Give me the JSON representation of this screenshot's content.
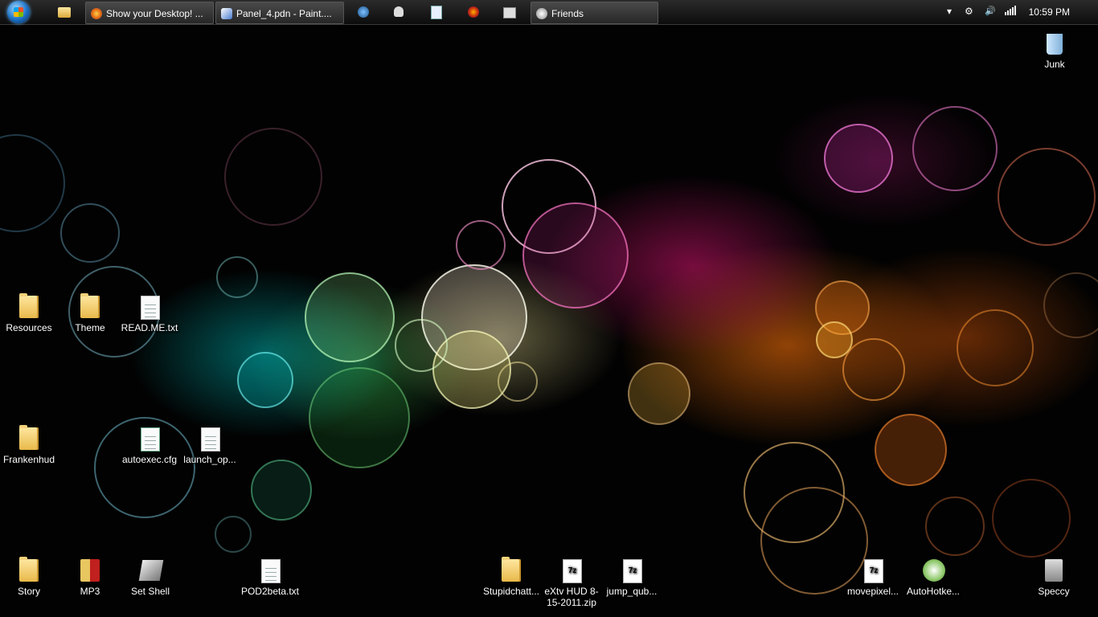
{
  "taskbar": {
    "tasks": [
      {
        "label": "Show your Desktop! ...",
        "icon": "firefox-icon"
      },
      {
        "label": "Panel_4.pdn - Paint....",
        "icon": "paint-net-icon"
      },
      {
        "label": "Friends",
        "icon": "steam-icon"
      }
    ],
    "quicklaunch": [
      "folder-icon",
      "globe-icon",
      "skull-icon",
      "notepad-icon",
      "app-icon",
      "wifi-tool-icon"
    ],
    "tray": {
      "overflow": "▾",
      "steam": "⚙",
      "volume": "🔊",
      "network": "▮"
    },
    "clock": "10:59 PM"
  },
  "desktop": {
    "icons": [
      {
        "label": "Junk",
        "type": "recycle-bin"
      },
      {
        "label": "Resources",
        "type": "folder"
      },
      {
        "label": "Theme",
        "type": "folder"
      },
      {
        "label": "READ.ME.txt",
        "type": "text-file"
      },
      {
        "label": "Frankenhud",
        "type": "folder"
      },
      {
        "label": "autoexec.cfg",
        "type": "cfg-file"
      },
      {
        "label": "launch_op...",
        "type": "text-file"
      },
      {
        "label": "Story",
        "type": "folder"
      },
      {
        "label": "MP3",
        "type": "folder"
      },
      {
        "label": "Set Shell",
        "type": "shortcut"
      },
      {
        "label": "POD2beta.txt",
        "type": "text-file"
      },
      {
        "label": "Stupidchatt...",
        "type": "folder"
      },
      {
        "label": "eXtv HUD 8-15-2011.zip",
        "type": "archive"
      },
      {
        "label": "jump_qub...",
        "type": "archive"
      },
      {
        "label": "movepixel...",
        "type": "archive"
      },
      {
        "label": "AutoHotke...",
        "type": "installer"
      },
      {
        "label": "Speccy",
        "type": "application"
      }
    ]
  }
}
